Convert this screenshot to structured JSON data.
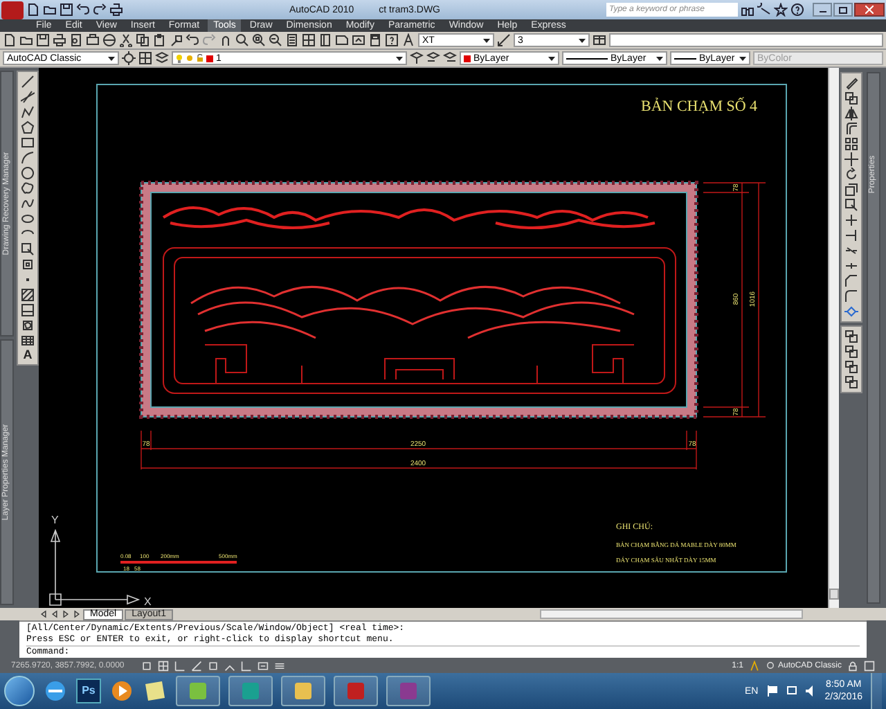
{
  "title_bar": {
    "app": "AutoCAD 2010",
    "file": "ct tram3.DWG",
    "search_placeholder": "Type a keyword or phrase"
  },
  "menu": [
    {
      "label": "File",
      "selected": false
    },
    {
      "label": "Edit",
      "selected": false
    },
    {
      "label": "View",
      "selected": false
    },
    {
      "label": "Insert",
      "selected": false
    },
    {
      "label": "Format",
      "selected": false
    },
    {
      "label": "Tools",
      "selected": true
    },
    {
      "label": "Draw",
      "selected": false
    },
    {
      "label": "Dimension",
      "selected": false
    },
    {
      "label": "Modify",
      "selected": false
    },
    {
      "label": "Parametric",
      "selected": false
    },
    {
      "label": "Window",
      "selected": false
    },
    {
      "label": "Help",
      "selected": false
    },
    {
      "label": "Express",
      "selected": false
    }
  ],
  "styles_toolbar": {
    "text_style": "XT",
    "dim_style": "3"
  },
  "properties_toolbar": {
    "workspace": "AutoCAD Classic",
    "layer": "1",
    "color_setting": "ByLayer",
    "linetype": "ByLayer",
    "lineweight": "ByLayer",
    "plot_style": "ByColor"
  },
  "left_palettes": [
    "Drawing Recovery Manager",
    "Layer Properties Manager"
  ],
  "draw_toolbar_text_tool": "A",
  "right_palette": "Properties",
  "drawing": {
    "title": "BẢN CHẠM SỐ 4",
    "vertical_dims": [
      "78",
      "860",
      "78",
      "1016"
    ],
    "horizontal_dims": [
      "78",
      "2250",
      "78",
      "2400"
    ],
    "notes_heading": "GHI CHÚ:",
    "notes": [
      "BẢN CHẠM BẰNG ĐÁ MABLE DÀY 80MM",
      "ĐÁY CHẠM SÂU NHẤT DÀY 15MM"
    ],
    "scale_labels": [
      "0.08",
      "100",
      "200mm",
      "500mm"
    ],
    "scale_sublabels": [
      "18",
      "58"
    ],
    "ucs": {
      "y": "Y",
      "x": "X"
    }
  },
  "layout_tabs": [
    {
      "label": "Model",
      "selected": true
    },
    {
      "label": "Layout1",
      "selected": false
    }
  ],
  "command_lines": [
    "[All/Center/Dynamic/Extents/Previous/Scale/Window/Object] <real time>:",
    "Press ESC or ENTER to exit, or right-click to display shortcut menu."
  ],
  "command_prompt": "Command:",
  "status_bar": {
    "coordinates": "7265.9720, 3857.7992, 0.0000",
    "scale": "1:1",
    "workspace": "AutoCAD Classic"
  },
  "taskbar": {
    "photoshop": "Ps",
    "language": "EN",
    "time": "8:50 AM",
    "date": "2/3/2016"
  }
}
